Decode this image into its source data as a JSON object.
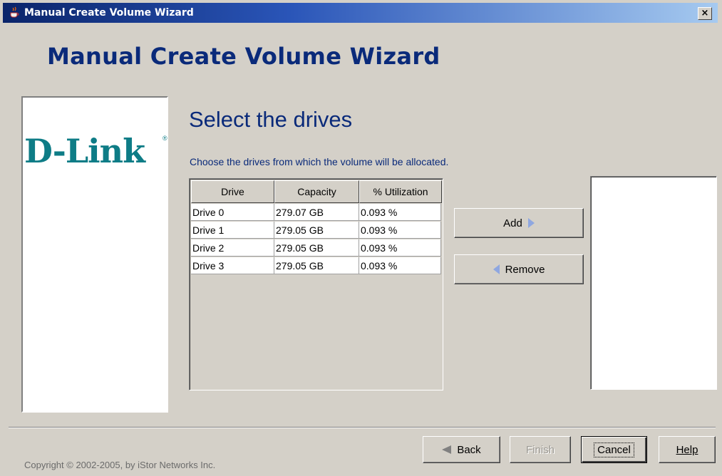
{
  "window": {
    "title": "Manual Create Volume Wizard",
    "close_label": "×"
  },
  "header": {
    "title": "Manual Create Volume Wizard"
  },
  "logo": {
    "text": "D-Link",
    "registered": "®"
  },
  "main": {
    "subtitle": "Select the drives",
    "instruction": "Choose the drives from which the volume will be allocated.",
    "table": {
      "columns": [
        "Drive",
        "Capacity",
        "% Utilization"
      ],
      "rows": [
        [
          "Drive 0",
          "279.07 GB",
          "0.093 %"
        ],
        [
          "Drive 1",
          "279.05 GB",
          "0.093 %"
        ],
        [
          "Drive 2",
          "279.05 GB",
          "0.093 %"
        ],
        [
          "Drive 3",
          "279.05 GB",
          "0.093 %"
        ]
      ]
    },
    "add_label": "Add",
    "remove_label": "Remove",
    "selected_drives": []
  },
  "footer": {
    "back_label": "Back",
    "finish_label": "Finish",
    "cancel_label": "Cancel",
    "help_label": "Help",
    "copyright": "Copyright © 2002-2005, by iStor Networks Inc."
  },
  "colors": {
    "title_blue": "#0a2a7a",
    "logo_teal": "#0e7c86",
    "dialog_gray": "#d4d0c8"
  }
}
